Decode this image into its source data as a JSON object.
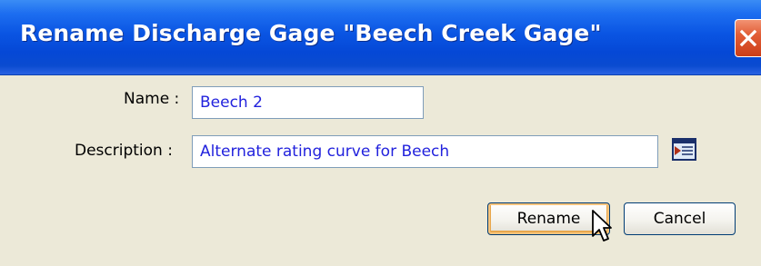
{
  "dialog": {
    "title": "Rename Discharge Gage \"Beech Creek Gage\""
  },
  "form": {
    "name_label": "Name :",
    "name_value": "Beech 2",
    "description_label": "Description :",
    "description_value": "Alternate rating curve for Beech"
  },
  "buttons": {
    "rename_label": "Rename",
    "cancel_label": "Cancel"
  },
  "icons": {
    "close": "close-icon",
    "browse": "text-editor-icon",
    "cursor": "mouse-pointer-icon"
  },
  "colors": {
    "title_bar": "#0a55e3",
    "close_button": "#e25e37",
    "dialog_background": "#ece9d8",
    "field_text": "#2222dd",
    "default_button_highlight": "#f7c47c"
  }
}
